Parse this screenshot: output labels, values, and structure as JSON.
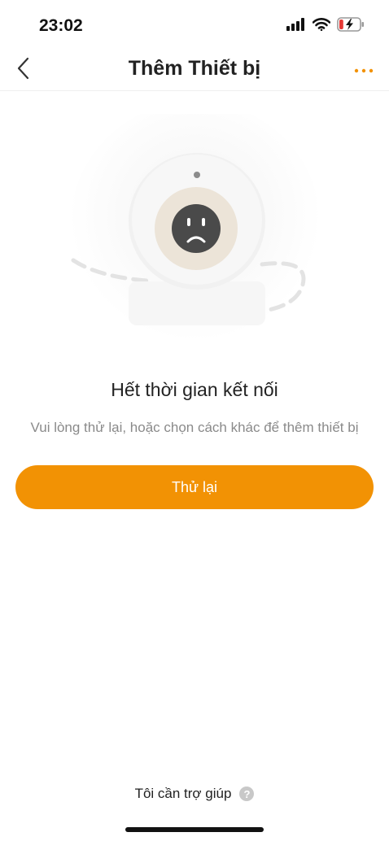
{
  "status_bar": {
    "time": "23:02",
    "icons": [
      "signal-icon",
      "wifi-icon",
      "battery-charging-icon"
    ],
    "battery_level": 0.2
  },
  "nav": {
    "title": "Thêm Thiết bị",
    "back_icon": "chevron-left-icon",
    "more_icon": "more-dots-icon"
  },
  "main": {
    "headline": "Hết thời gian kết nối",
    "subtext": "Vui lòng thử lại, hoặc chọn cách khác để thêm thiết bị",
    "retry_label": "Thử lại"
  },
  "footer": {
    "help_label": "Tôi cần trợ giúp",
    "help_icon_glyph": "?"
  },
  "colors": {
    "accent": "#f29204",
    "battery_low": "#e53935"
  }
}
